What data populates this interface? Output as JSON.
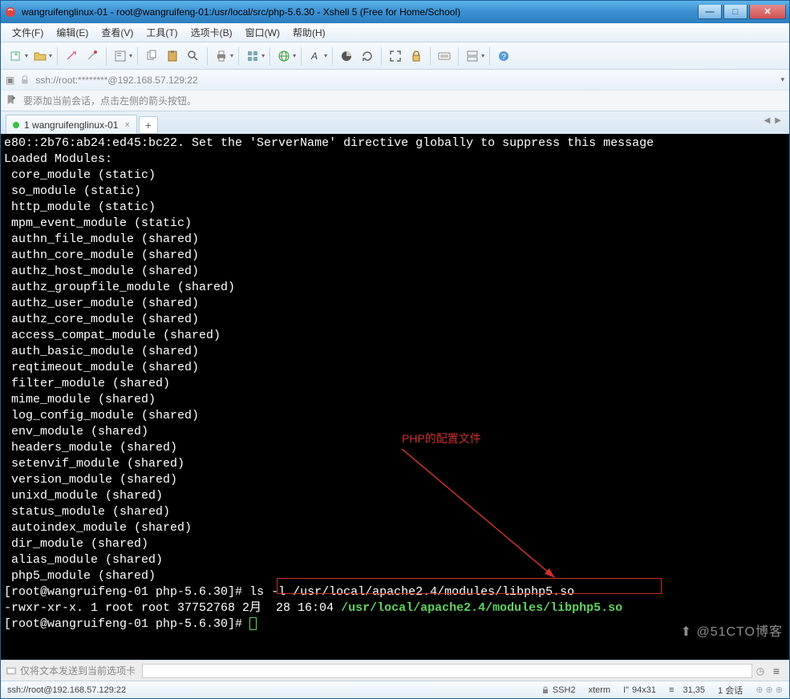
{
  "title": "wangruifenglinux-01 - root@wangruifeng-01:/usr/local/src/php-5.6.30 - Xshell 5 (Free for Home/School)",
  "menu": {
    "file": "文件(F)",
    "edit": "编辑(E)",
    "view": "查看(V)",
    "tools": "工具(T)",
    "tab": "选项卡(B)",
    "window": "窗口(W)",
    "help": "帮助(H)"
  },
  "address": "ssh://root:********@192.168.57.129:22",
  "hint": "要添加当前会话，点击左侧的箭头按钮。",
  "tab": {
    "index": "1",
    "name": "wangruifenglinux-01"
  },
  "terminal_lines": [
    "e80::2b76:ab24:ed45:bc22. Set the 'ServerName' directive globally to suppress this message",
    "Loaded Modules:",
    " core_module (static)",
    " so_module (static)",
    " http_module (static)",
    " mpm_event_module (static)",
    " authn_file_module (shared)",
    " authn_core_module (shared)",
    " authz_host_module (shared)",
    " authz_groupfile_module (shared)",
    " authz_user_module (shared)",
    " authz_core_module (shared)",
    " access_compat_module (shared)",
    " auth_basic_module (shared)",
    " reqtimeout_module (shared)",
    " filter_module (shared)",
    " mime_module (shared)",
    " log_config_module (shared)",
    " env_module (shared)",
    " headers_module (shared)",
    " setenvif_module (shared)",
    " version_module (shared)",
    " unixd_module (shared)",
    " status_module (shared)",
    " autoindex_module (shared)",
    " dir_module (shared)",
    " alias_module (shared)",
    " php5_module (shared)"
  ],
  "prompt1_pre": "[root@wangruifeng-01 php-5.6.30]# ",
  "prompt1_cmd": "ls -l /usr/local/apache2.4/modules/libphp5.so",
  "ls_output_pre": "-rwxr-xr-x. 1 root root 37752768 2月  28 16:04 ",
  "ls_output_path": "/usr/local/apache2.4/modules/libphp5.so",
  "prompt2_pre": "[root@wangruifeng-01 php-5.6.30]# ",
  "annotation": "PHP的配置文件",
  "sendbar_label": "仅将文本发送到当前选项卡",
  "status": {
    "ssh": "ssh://root@192.168.57.129:22",
    "proto": "SSH2",
    "term": "xterm",
    "size": "94x31",
    "pos": "31,35",
    "sessions": "1 会话"
  },
  "watermark": "⬆ @51CTO博客"
}
